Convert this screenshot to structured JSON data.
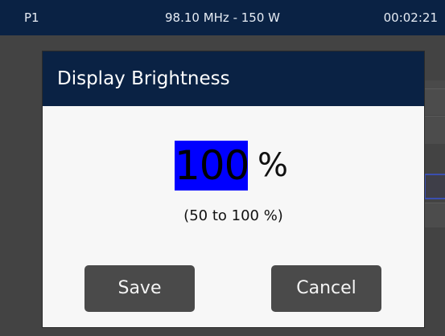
{
  "status_bar": {
    "preset": "P1",
    "frequency_power": "98.10 MHz - 150 W",
    "time": "00:02:21"
  },
  "dialog": {
    "title": "Display Brightness",
    "value": "100",
    "unit": "%",
    "range": "(50 to 100 %)",
    "save_label": "Save",
    "cancel_label": "Cancel"
  },
  "colors": {
    "header_bg": "#0a2244",
    "value_highlight": "#0000ff",
    "button_bg": "#4a4a4a",
    "dialog_bg": "#f7f7f7"
  }
}
